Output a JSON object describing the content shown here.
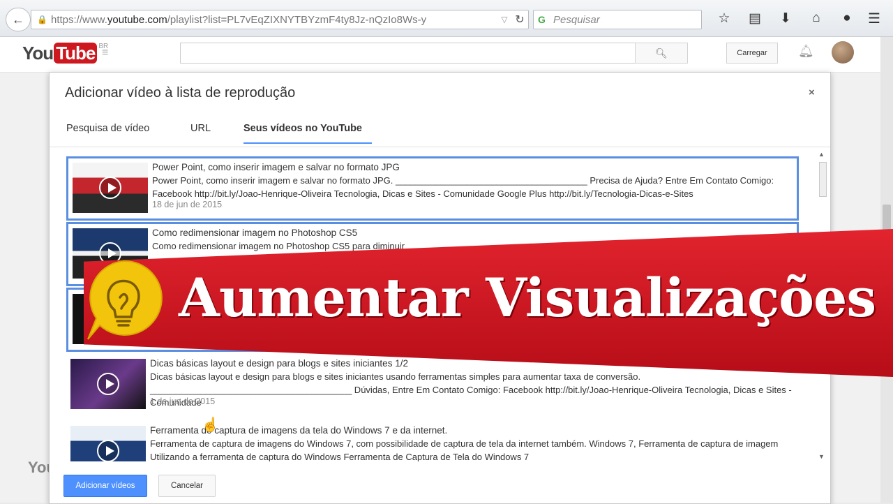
{
  "browser": {
    "url_prefix": "https://www.",
    "url_domain": "youtube.com",
    "url_rest": "/playlist?list=PL7vEqZIXNYTBYzmF4ty8Jz-nQzIo8Ws-y",
    "search_placeholder": "Pesquisar"
  },
  "youtube": {
    "logo_you": "You",
    "logo_tube": "Tube",
    "logo_region": "BR",
    "upload_label": "Carregar",
    "footer_logo": "You"
  },
  "dialog": {
    "title": "Adicionar vídeo à lista de reprodução",
    "close": "×",
    "tabs": [
      {
        "label": "Pesquisa de vídeo",
        "active": false
      },
      {
        "label": "URL",
        "active": false
      },
      {
        "label": "Seus vídeos no YouTube",
        "active": true
      }
    ],
    "videos": [
      {
        "title": "Power Point, como inserir imagem e salvar no formato JPG",
        "description": "Power Point, como inserir imagem e salvar no formato JPG. ______________________________________ Precisa de Ajuda? Entre Em Contato Comigo: Facebook http://bit.ly/Joao-Henrique-Oliveira Tecnologia, Dicas e Sites - Comunidade Google Plus http://bit.ly/Tecnologia-Dicas-e-Sites",
        "date": "18 de jun de 2015",
        "selected": true
      },
      {
        "title": "Como redimensionar imagem no Photoshop CS5",
        "description": "Como redimensionar imagem no Photoshop CS5 para diminuir",
        "date": "",
        "selected": true
      },
      {
        "title": "",
        "description": "",
        "date": "",
        "selected": true
      },
      {
        "title": "Dicas básicas layout e design para blogs e sites iniciantes 1/2",
        "description": "Dicas básicas layout e design para blogs e sites iniciantes usando ferramentas simples para aumentar taxa de conversão. ________________________________________ Dúvidas, Entre Em Contato Comigo: Facebook http://bit.ly/Joao-Henrique-Oliveira Tecnologia, Dicas e Sites - Comunidade",
        "date": "1 de jun de 2015",
        "selected": false
      },
      {
        "title": "Ferramenta de captura de imagens da tela do Windows 7 e da internet.",
        "description": "Ferramenta de captura de imagens do Windows 7, com possibilidade de captura de tela da internet também. Windows 7, Ferramenta de captura de imagem Utilizando a ferramenta de captura do Windows Ferramenta de Captura de Tela do Windows 7",
        "date": "",
        "selected": false
      }
    ],
    "add_button": "Adicionar vídeos",
    "cancel_button": "Cancelar"
  },
  "banner": {
    "text": "Aumentar Visualizações"
  },
  "colors": {
    "banner_red": "#d81c26",
    "bulb_yellow": "#f2c40c",
    "primary_blue": "#4d90fe",
    "youtube_red": "#cc181e"
  }
}
